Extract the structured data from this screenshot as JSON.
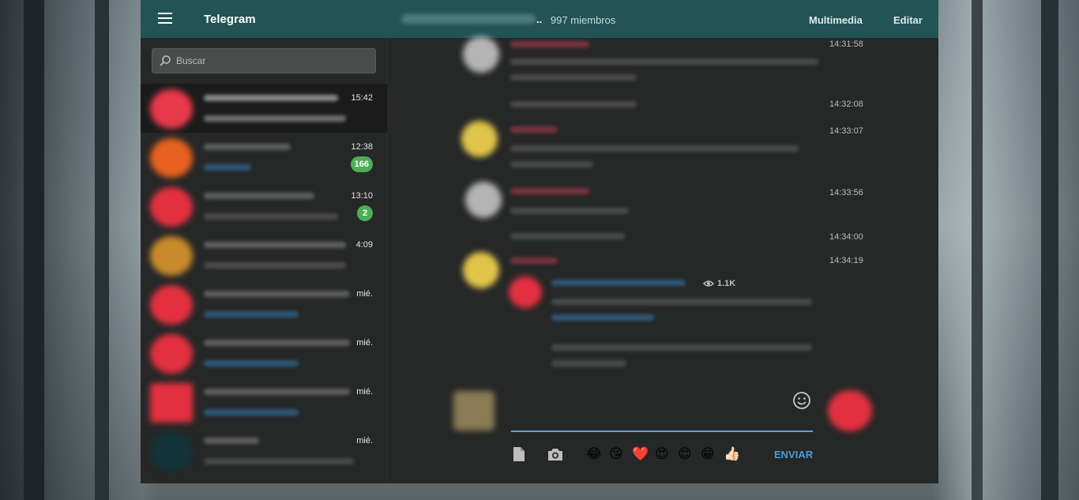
{
  "header": {
    "app_title": "Telegram",
    "chat_dots": "..",
    "members": "997 miembros",
    "media_label": "Multimedia",
    "edit_label": "Editar"
  },
  "search": {
    "placeholder": "Buscar"
  },
  "chats": [
    {
      "time": "15:42",
      "badge": ""
    },
    {
      "time": "12:38",
      "badge": "166"
    },
    {
      "time": "13:10",
      "badge": "2"
    },
    {
      "time": "4:09",
      "badge": ""
    },
    {
      "time": "mié.",
      "badge": ""
    },
    {
      "time": "mié.",
      "badge": ""
    },
    {
      "time": "mié.",
      "badge": ""
    },
    {
      "time": "mié.",
      "badge": ""
    }
  ],
  "messages": [
    {
      "time": "14:31:58"
    },
    {
      "time": "14:32:08"
    },
    {
      "time": "14:33:07"
    },
    {
      "time": "14:33:56"
    },
    {
      "time": "14:34:00"
    },
    {
      "time": "14:34:19"
    }
  ],
  "forward": {
    "views": "1.1K"
  },
  "composer": {
    "send_label": "ENVIAR",
    "emojis": [
      "😂",
      "😘",
      "❤️",
      "😍",
      "😊",
      "😁",
      "👍🏻"
    ]
  },
  "colors": {
    "header": "#225355",
    "panel": "#262727",
    "badge": "#4cae55",
    "accent": "#4a9bd8"
  }
}
